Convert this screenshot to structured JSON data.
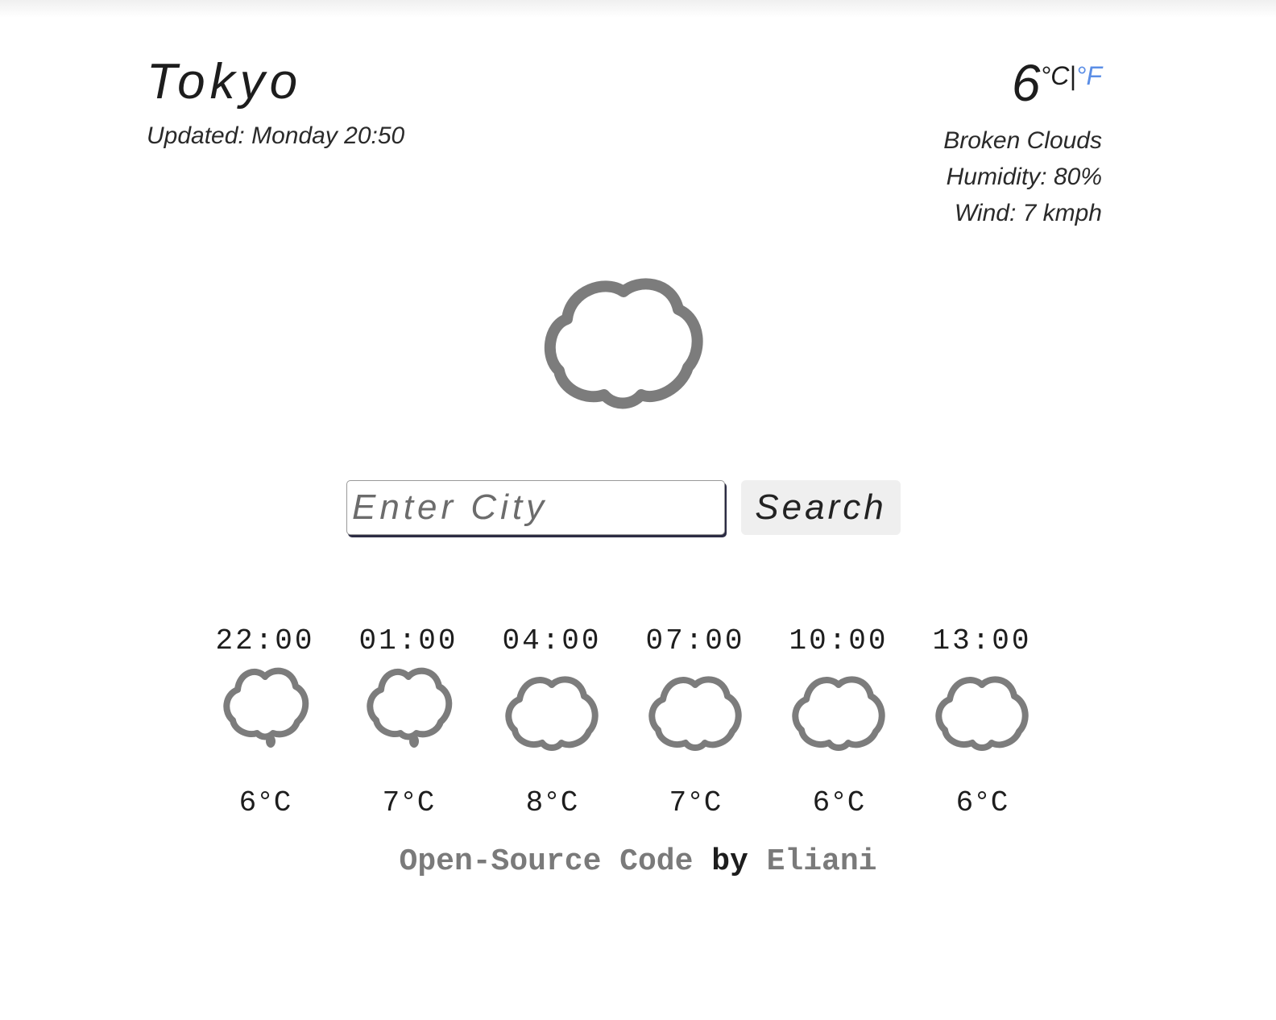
{
  "header": {
    "city": "Tokyo",
    "updated": "Updated: Monday 20:50"
  },
  "current": {
    "temperature": "6",
    "unit_c": "°C",
    "unit_separator": "|",
    "unit_f": "°F",
    "description": "Broken Clouds",
    "humidity": "Humidity: 80%",
    "wind": "Wind: 7 kmph",
    "icon": "cloud-icon"
  },
  "search": {
    "placeholder": "Enter City",
    "value": "",
    "button_label": "Search"
  },
  "forecast": [
    {
      "time": "22:00",
      "temp": "6°C",
      "icon": "cloud-drizzle-icon"
    },
    {
      "time": "01:00",
      "temp": "7°C",
      "icon": "cloud-drizzle-icon"
    },
    {
      "time": "04:00",
      "temp": "8°C",
      "icon": "cloud-icon"
    },
    {
      "time": "07:00",
      "temp": "7°C",
      "icon": "cloud-icon"
    },
    {
      "time": "10:00",
      "temp": "6°C",
      "icon": "cloud-icon"
    },
    {
      "time": "13:00",
      "temp": "6°C",
      "icon": "cloud-icon"
    }
  ],
  "footer": {
    "link_text": "Open-Source Code",
    "by_text": "by",
    "author": "Eliani"
  },
  "colors": {
    "accent": "#5b8ee6",
    "icon_stroke": "#7c7c7c"
  }
}
